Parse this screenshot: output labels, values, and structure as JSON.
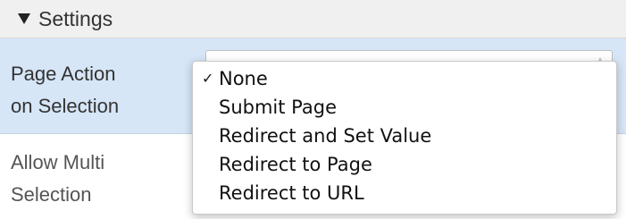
{
  "settings": {
    "title": "Settings",
    "rows": [
      {
        "label_line1": "Page Action",
        "label_line2": "on Selection"
      },
      {
        "label_line1": "Allow Multi",
        "label_line2": "Selection"
      }
    ]
  },
  "dropdown": {
    "selected": "None",
    "check_glyph": "✓",
    "options": [
      {
        "label": "None"
      },
      {
        "label": "Submit Page"
      },
      {
        "label": "Redirect and Set Value"
      },
      {
        "label": "Redirect to Page"
      },
      {
        "label": "Redirect to URL"
      }
    ]
  },
  "colors": {
    "header_bg": "#f0f0f0",
    "selected_row_bg": "#d6e6f7"
  },
  "icons": {
    "collapse": "triangle-down-icon",
    "select_arrows": "updown-arrows-icon",
    "selected_mark": "check-icon"
  }
}
